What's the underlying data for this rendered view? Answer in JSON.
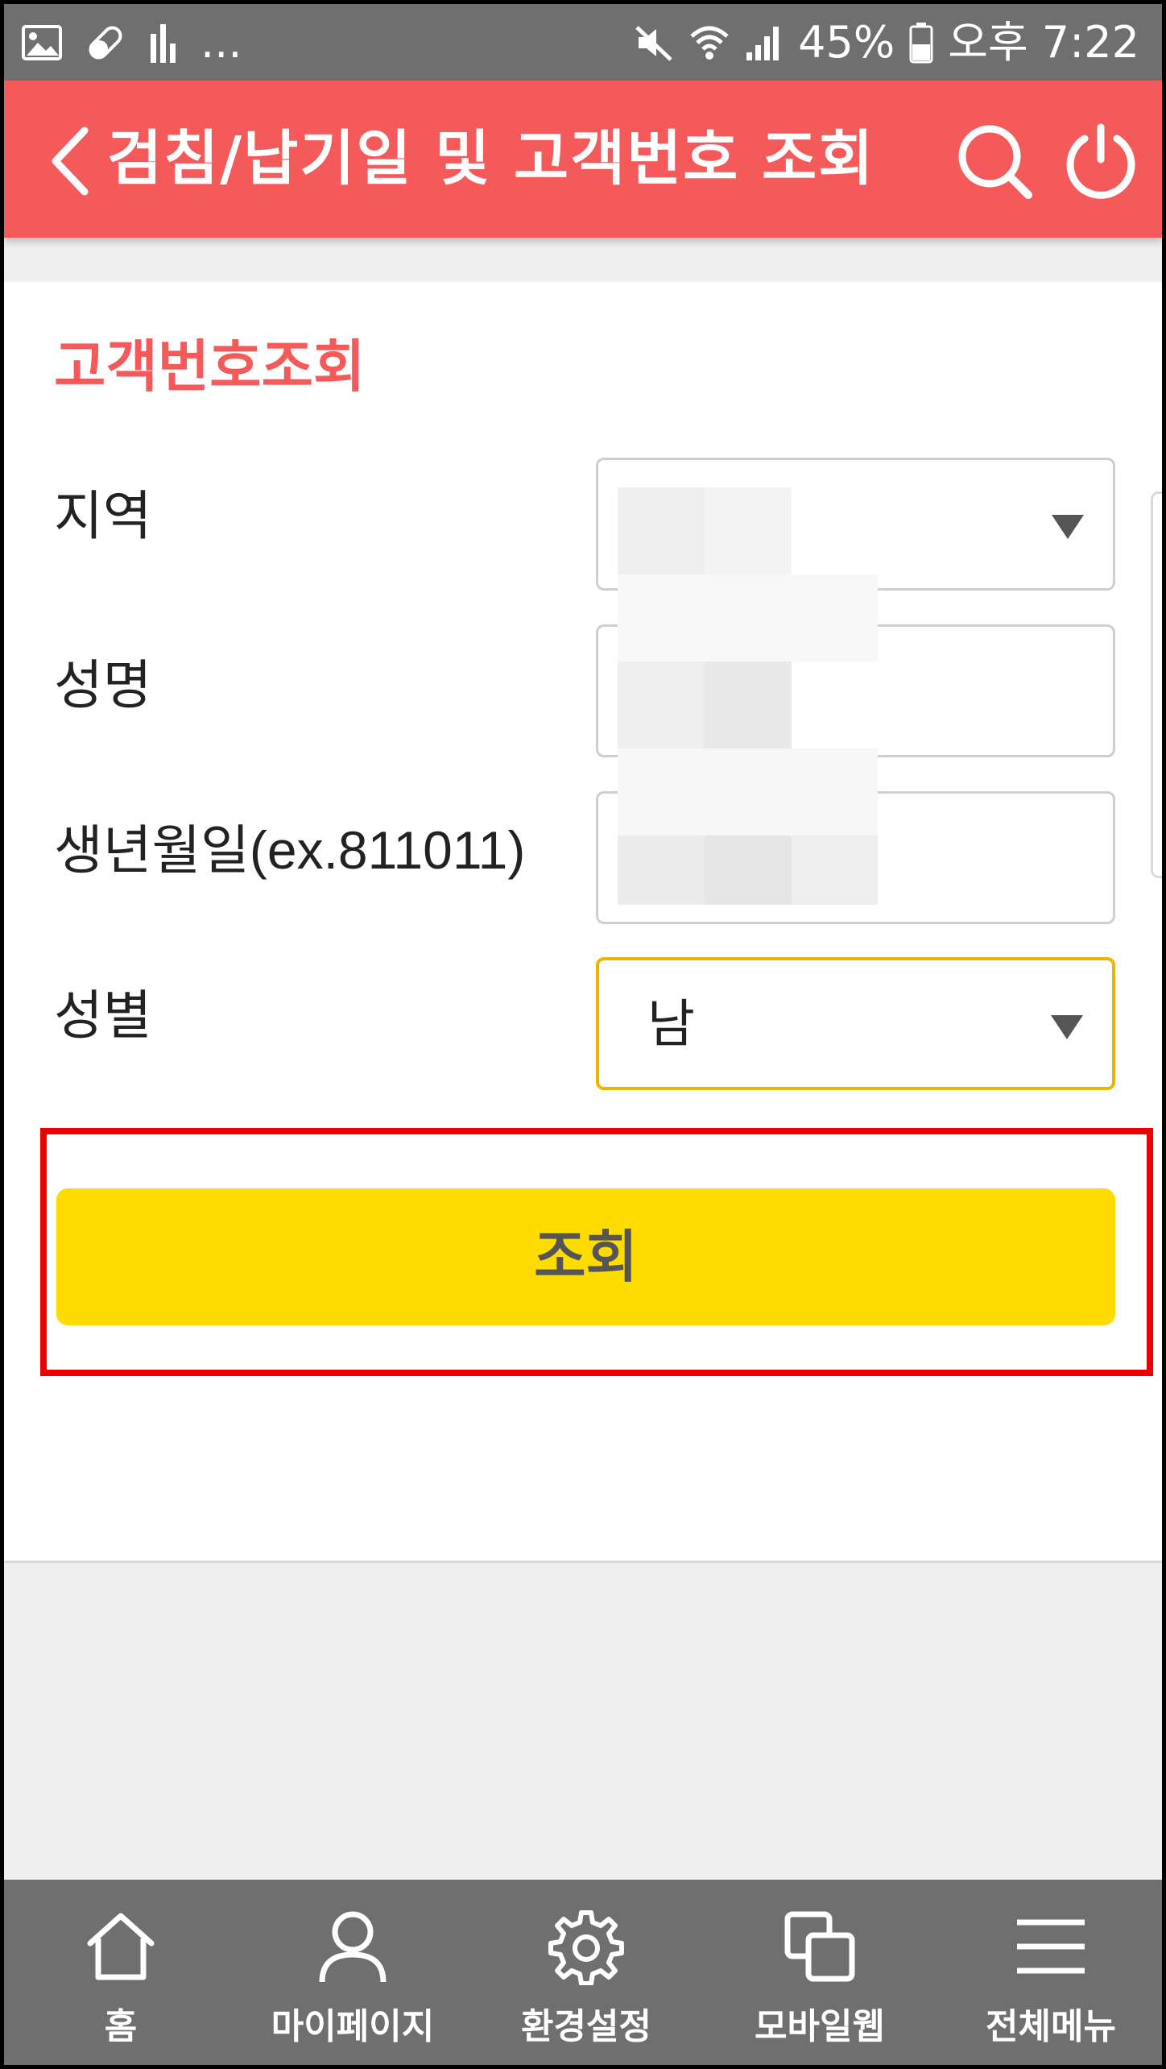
{
  "status_bar": {
    "overflow_indicator": "...",
    "battery_percent": "45%",
    "time": "오후 7:22",
    "icons": [
      "gallery-icon",
      "pill-icon",
      "equalizer-icon",
      "mute-icon",
      "wifi-icon",
      "signal-icon",
      "battery-icon"
    ]
  },
  "header": {
    "title": "검침/납기일 및 고객번호 조회",
    "icons": [
      "back-chevron-icon",
      "search-icon",
      "power-icon"
    ],
    "background": "#f55a5a"
  },
  "section": {
    "title": "고객번호조회"
  },
  "form": {
    "region_label": "지역",
    "region_value": "",
    "name_label": "성명",
    "name_value": "",
    "birth_label": "생년월일(ex.811011)",
    "birth_value": "",
    "gender_label": "성별",
    "gender_value": "남"
  },
  "submit": {
    "label": "조회",
    "color": "#ffdc00"
  },
  "bottom_nav": {
    "items": [
      {
        "label": "홈",
        "icon": "home-icon"
      },
      {
        "label": "마이페이지",
        "icon": "user-icon"
      },
      {
        "label": "환경설정",
        "icon": "gear-icon"
      },
      {
        "label": "모바일웹",
        "icon": "windows-icon"
      },
      {
        "label": "전체메뉴",
        "icon": "menu-icon"
      }
    ]
  }
}
